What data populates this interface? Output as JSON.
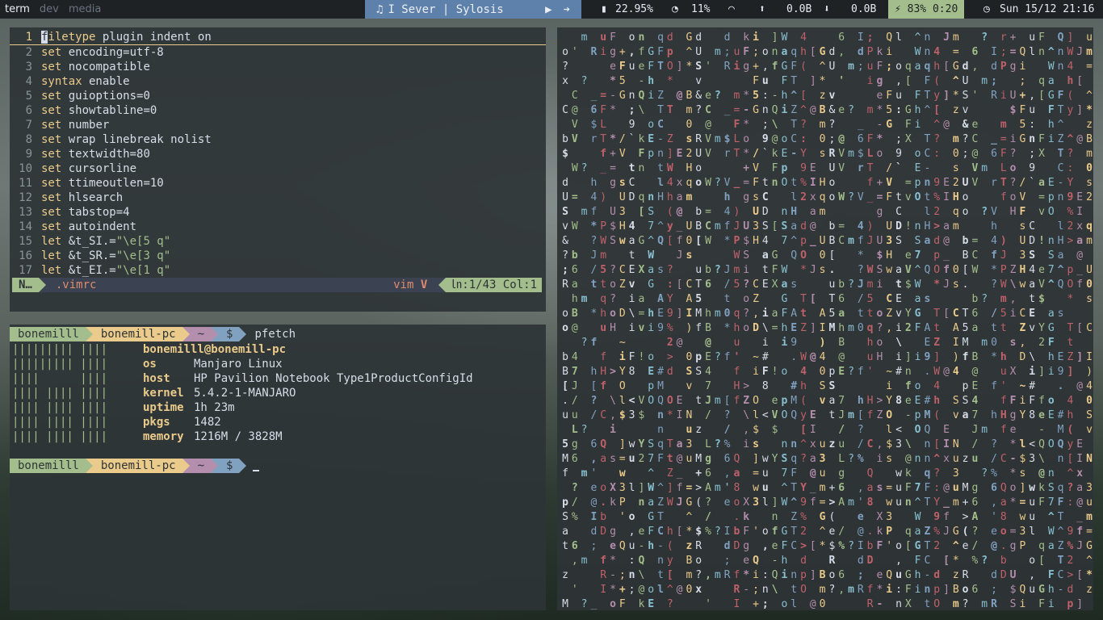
{
  "topbar": {
    "workspaces": [
      "term",
      "dev",
      "media"
    ],
    "now_playing": "I Sever | Sylosis",
    "cpu": "22.95%",
    "memory": "11%",
    "upload": "0.0B",
    "download": "0.0B",
    "battery": "83% 0:20",
    "clock": "Sun 15/12 21:16"
  },
  "vim": {
    "lines": [
      {
        "n": "1",
        "kw": "filetype",
        "rest": " plugin indent on"
      },
      {
        "n": "2",
        "kw": "set",
        "rest": " encoding=utf-8"
      },
      {
        "n": "3",
        "kw": "set",
        "rest": " nocompatible"
      },
      {
        "n": "4",
        "kw": "syntax",
        "rest": " enable"
      },
      {
        "n": "5",
        "kw": "set",
        "rest": " guioptions=0"
      },
      {
        "n": "6",
        "kw": "set",
        "rest": " showtabline=0"
      },
      {
        "n": "7",
        "kw": "set",
        "rest": " number"
      },
      {
        "n": "8",
        "kw": "set",
        "rest": " wrap linebreak nolist"
      },
      {
        "n": "9",
        "kw": "set",
        "rest": " textwidth=80"
      },
      {
        "n": "10",
        "kw": "set",
        "rest": " cursorline"
      },
      {
        "n": "11",
        "kw": "set",
        "rest": " ttimeoutlen=10"
      },
      {
        "n": "12",
        "kw": "set",
        "rest": " hlsearch"
      },
      {
        "n": "13",
        "kw": "set",
        "rest": " tabstop=4"
      },
      {
        "n": "14",
        "kw": "set",
        "rest": " autoindent"
      },
      {
        "n": "15",
        "kw": "let",
        "rest": " &t_SI.=",
        "str": "\"\\e[5 q\""
      },
      {
        "n": "16",
        "kw": "let",
        "rest": " &t_SR.=",
        "str": "\"\\e[3 q\""
      },
      {
        "n": "17",
        "kw": "let",
        "rest": " &t_EI.=",
        "str": "\"\\e[1 q\""
      }
    ],
    "status": {
      "mode": "N…",
      "file": ".vimrc",
      "filetype": "vim",
      "filetype_icon": "V",
      "position": "㏑:1/43 Col:1"
    }
  },
  "terminal": {
    "prompt": {
      "user": "bonemilll",
      "host": "bonemill-pc",
      "dir": "~",
      "symbol": "$"
    },
    "command": "pfetch",
    "pfetch": {
      "header": "bonemilll@bonemill-pc",
      "logo": [
        "||||||||| ||||",
        "||||||||| ||||",
        "||||      ||||",
        "|||| |||| ||||",
        "|||| |||| ||||",
        "|||| |||| ||||",
        "|||| |||| ||||"
      ],
      "rows": [
        {
          "key": "os",
          "val": "Manjaro Linux"
        },
        {
          "key": "host",
          "val": "HP Pavilion Notebook Type1ProductConfigId"
        },
        {
          "key": "kernel",
          "val": "5.4.2-1-MANJARO"
        },
        {
          "key": "uptime",
          "val": "1h 23m"
        },
        {
          "key": "pkgs",
          "val": "1482"
        },
        {
          "key": "memory",
          "val": "1216M / 3828M"
        }
      ]
    }
  },
  "matrix": {
    "columns": [
      "Ro?x C b$ dUSv&?;RUoo bB[.uT5Mf pSat z M+>(e$",
      "A?/% 6, ' eC@VV W =CW b6ahB@E47J/uLg6",
      "?  m  ",
      "?/%6,'e@Id;R  _6$r Vh4f*?J/t0* f h[",
      "RIwr;Pui m=FLTf_ )JPWm5tqhu'fHf C Qa8o.bD f",
      "XkFge*-*o*+=g U$Si?o?oH  >Z\\,i s ",
      "]=w3P' Qi;+F5G  /VFsU3Hw CZ,D ~iYOl$s",
      "wuul o,u:n;9` tCDS4atEvi\\i#F8 <3 ",
      "]nfe-Q\\@kFn q[ GFX a=v ! eV$ Y2 ",
      "pO nS7^WaGFhi oE",
      "MQnnqFT^ZTC-ntlHa^Q s AE9. #",
      "dpO* TtZ]W4h(y[^?:Y9%2>",
      "xa@_fJ [ ] @   EI",
      "um=G^*zBm0s2Hqm U0s CAI)40Sv Nu3"
    ]
  },
  "colors": {
    "accent_green": "#a3be8c",
    "accent_yellow": "#ebcb8b",
    "accent_purple": "#b48ead",
    "accent_blue": "#81a1c1",
    "mpd_blue": "#5e81ac",
    "text": "#d8dee9"
  }
}
